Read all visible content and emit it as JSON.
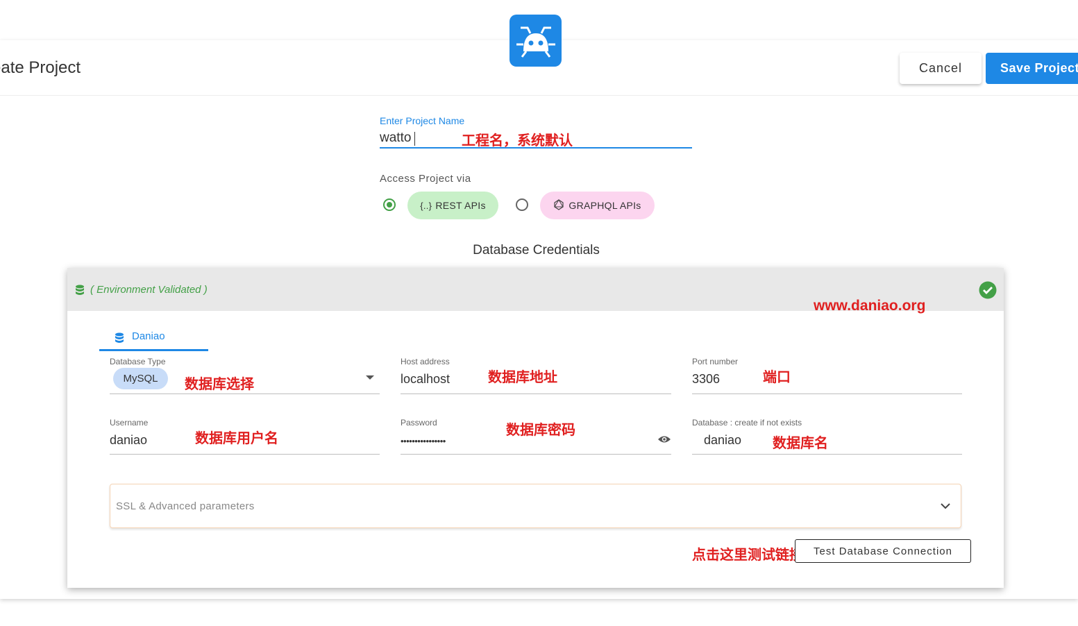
{
  "header": {
    "title": "eate Project",
    "cancel_label": "Cancel",
    "save_label": "Save Project"
  },
  "project_name": {
    "label": "Enter Project Name",
    "value": "watto",
    "annotation": "工程名，系统默认"
  },
  "access": {
    "label": "Access Project via",
    "options": [
      {
        "label": "REST APIs",
        "icon_text": "{..}",
        "selected": true,
        "color": "#c8f0c8"
      },
      {
        "label": "GRAPHQL APIs",
        "selected": false,
        "color": "#fcd5ef"
      }
    ]
  },
  "db_credentials": {
    "title": "Database Credentials",
    "env_status": "( Environment Validated )",
    "watermark": "www.daniao.org",
    "tab_label": "Daniao",
    "fields": {
      "db_type": {
        "label": "Database Type",
        "value": "MySQL",
        "annotation": "数据库选择"
      },
      "host": {
        "label": "Host address",
        "value": "localhost",
        "annotation": "数据库地址"
      },
      "port": {
        "label": "Port number",
        "value": "3306",
        "annotation": "端口"
      },
      "username": {
        "label": "Username",
        "value": "daniao",
        "annotation": "数据库用户名"
      },
      "password": {
        "label": "Password",
        "value": "••••••••••••••••",
        "annotation": "数据库密码"
      },
      "database": {
        "label": "Database : create if not exists",
        "value": "daniao",
        "annotation": "数据库名"
      }
    },
    "ssl_label": "SSL & Advanced parameters",
    "test_annotation": "点击这里测试链接",
    "test_button_label": "Test Database Connection"
  },
  "colors": {
    "primary": "#1e88e5",
    "success": "#43a047",
    "annotation": "#e02020"
  },
  "icons": [
    "app-logo-icon",
    "database-icon",
    "check-circle-icon",
    "graphql-icon",
    "eye-icon",
    "chevron-down-icon"
  ]
}
